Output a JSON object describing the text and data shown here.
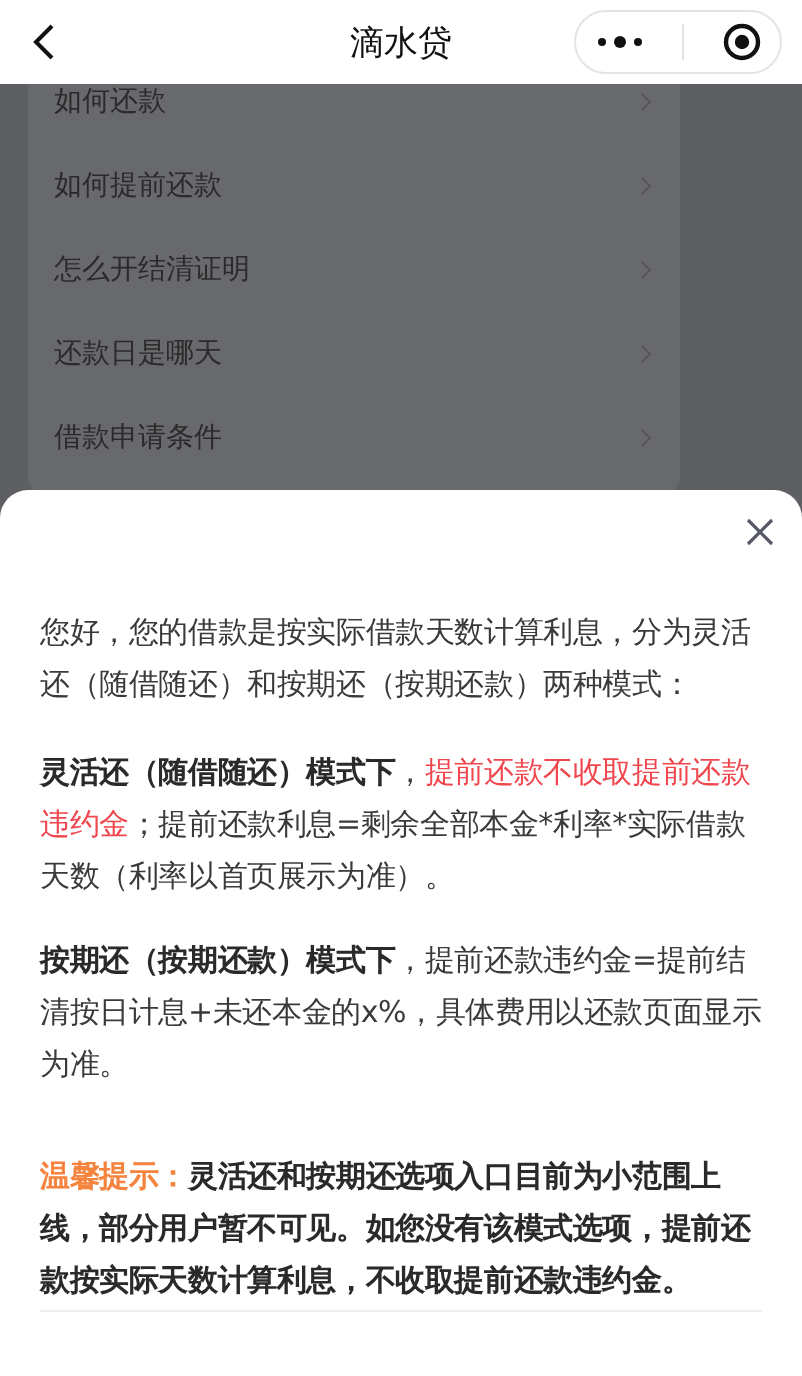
{
  "header": {
    "title": "滴水贷"
  },
  "faq_items": [
    {
      "label": "如何还款"
    },
    {
      "label": "如何提前还款"
    },
    {
      "label": "怎么开结清证明"
    },
    {
      "label": "还款日是哪天"
    },
    {
      "label": "借款申请条件"
    }
  ],
  "sheet": {
    "paragraphs": [
      [
        {
          "kind": "plain",
          "text": "您好，您的借款是按实际借款天数计算利息，分为灵活还（随借随还）和按期还（按期还款）两种模式："
        }
      ],
      [
        {
          "kind": "bold",
          "text": "灵活还（随借随还）模式下"
        },
        {
          "kind": "plain",
          "text": "，"
        },
        {
          "kind": "red",
          "text": "提前还款不收取提前还款违约金"
        },
        {
          "kind": "plain",
          "text": "；提前还款利息=剩余全部本金*利率*实际借款天数（利率以首页展示为准）。"
        }
      ],
      [
        {
          "kind": "bold",
          "text": "按期还（按期还款）模式下"
        },
        {
          "kind": "plain",
          "text": "，提前还款违约金=提前结清按日计息+未还本金的x%，具体费用以还款页面显示为准。"
        }
      ],
      [
        {
          "kind": "orange",
          "text": "温馨提示："
        },
        {
          "kind": "bold",
          "text": "灵活还和按期还选项入口目前为小范围上线，部分用户暂不可见。如您没有该模式选项，提前还款按实际天数计算利息，不收取提前还款违约金。"
        }
      ]
    ]
  }
}
